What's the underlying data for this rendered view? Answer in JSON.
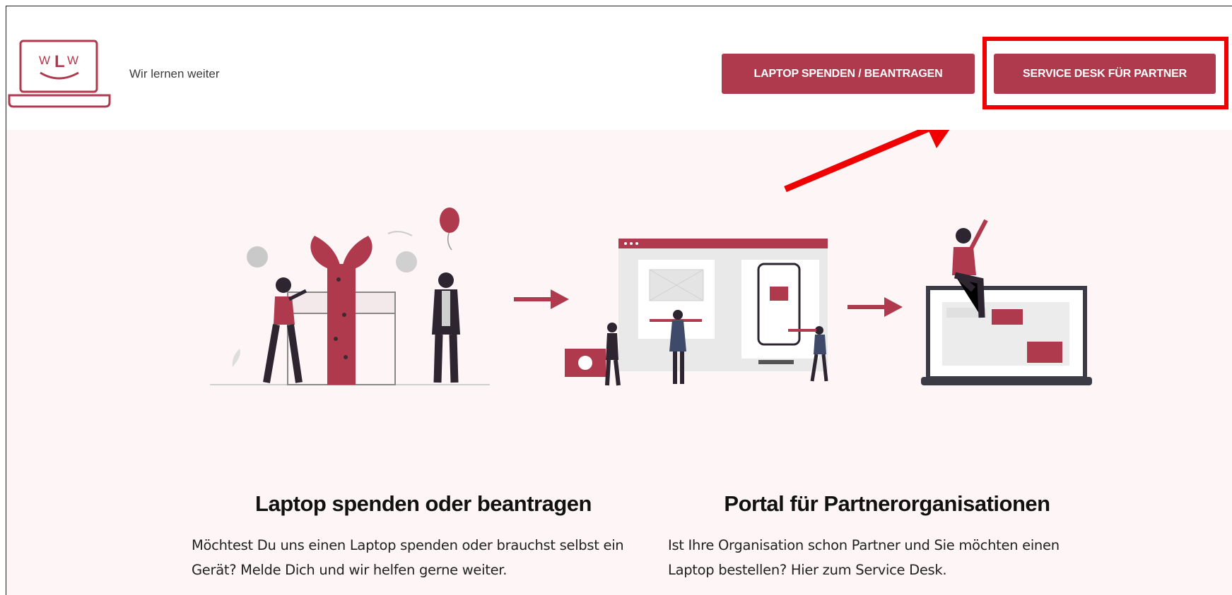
{
  "header": {
    "brand_name": "Wir lernen weiter",
    "logo_text": "WLW",
    "btn_donate": "LAPTOP SPENDEN / BEANTRAGEN",
    "btn_service": "SERVICE DESK FÜR PARTNER"
  },
  "annotation": {
    "highlight_color": "#f00000",
    "arrow_color": "#f00000"
  },
  "columns": [
    {
      "title": "Laptop spenden oder beantragen",
      "text": "Möchtest Du uns einen Laptop spenden oder brauchst selbst ein Gerät? Melde Dich und wir helfen gerne weiter."
    },
    {
      "title": "Portal für Partnerorganisationen",
      "text": "Ist Ihre Organisation schon Partner und Sie möchten einen Laptop bestellen? Hier zum Service Desk."
    }
  ],
  "colors": {
    "accent": "#b03a4d",
    "hero_bg": "#fdf5f6"
  }
}
